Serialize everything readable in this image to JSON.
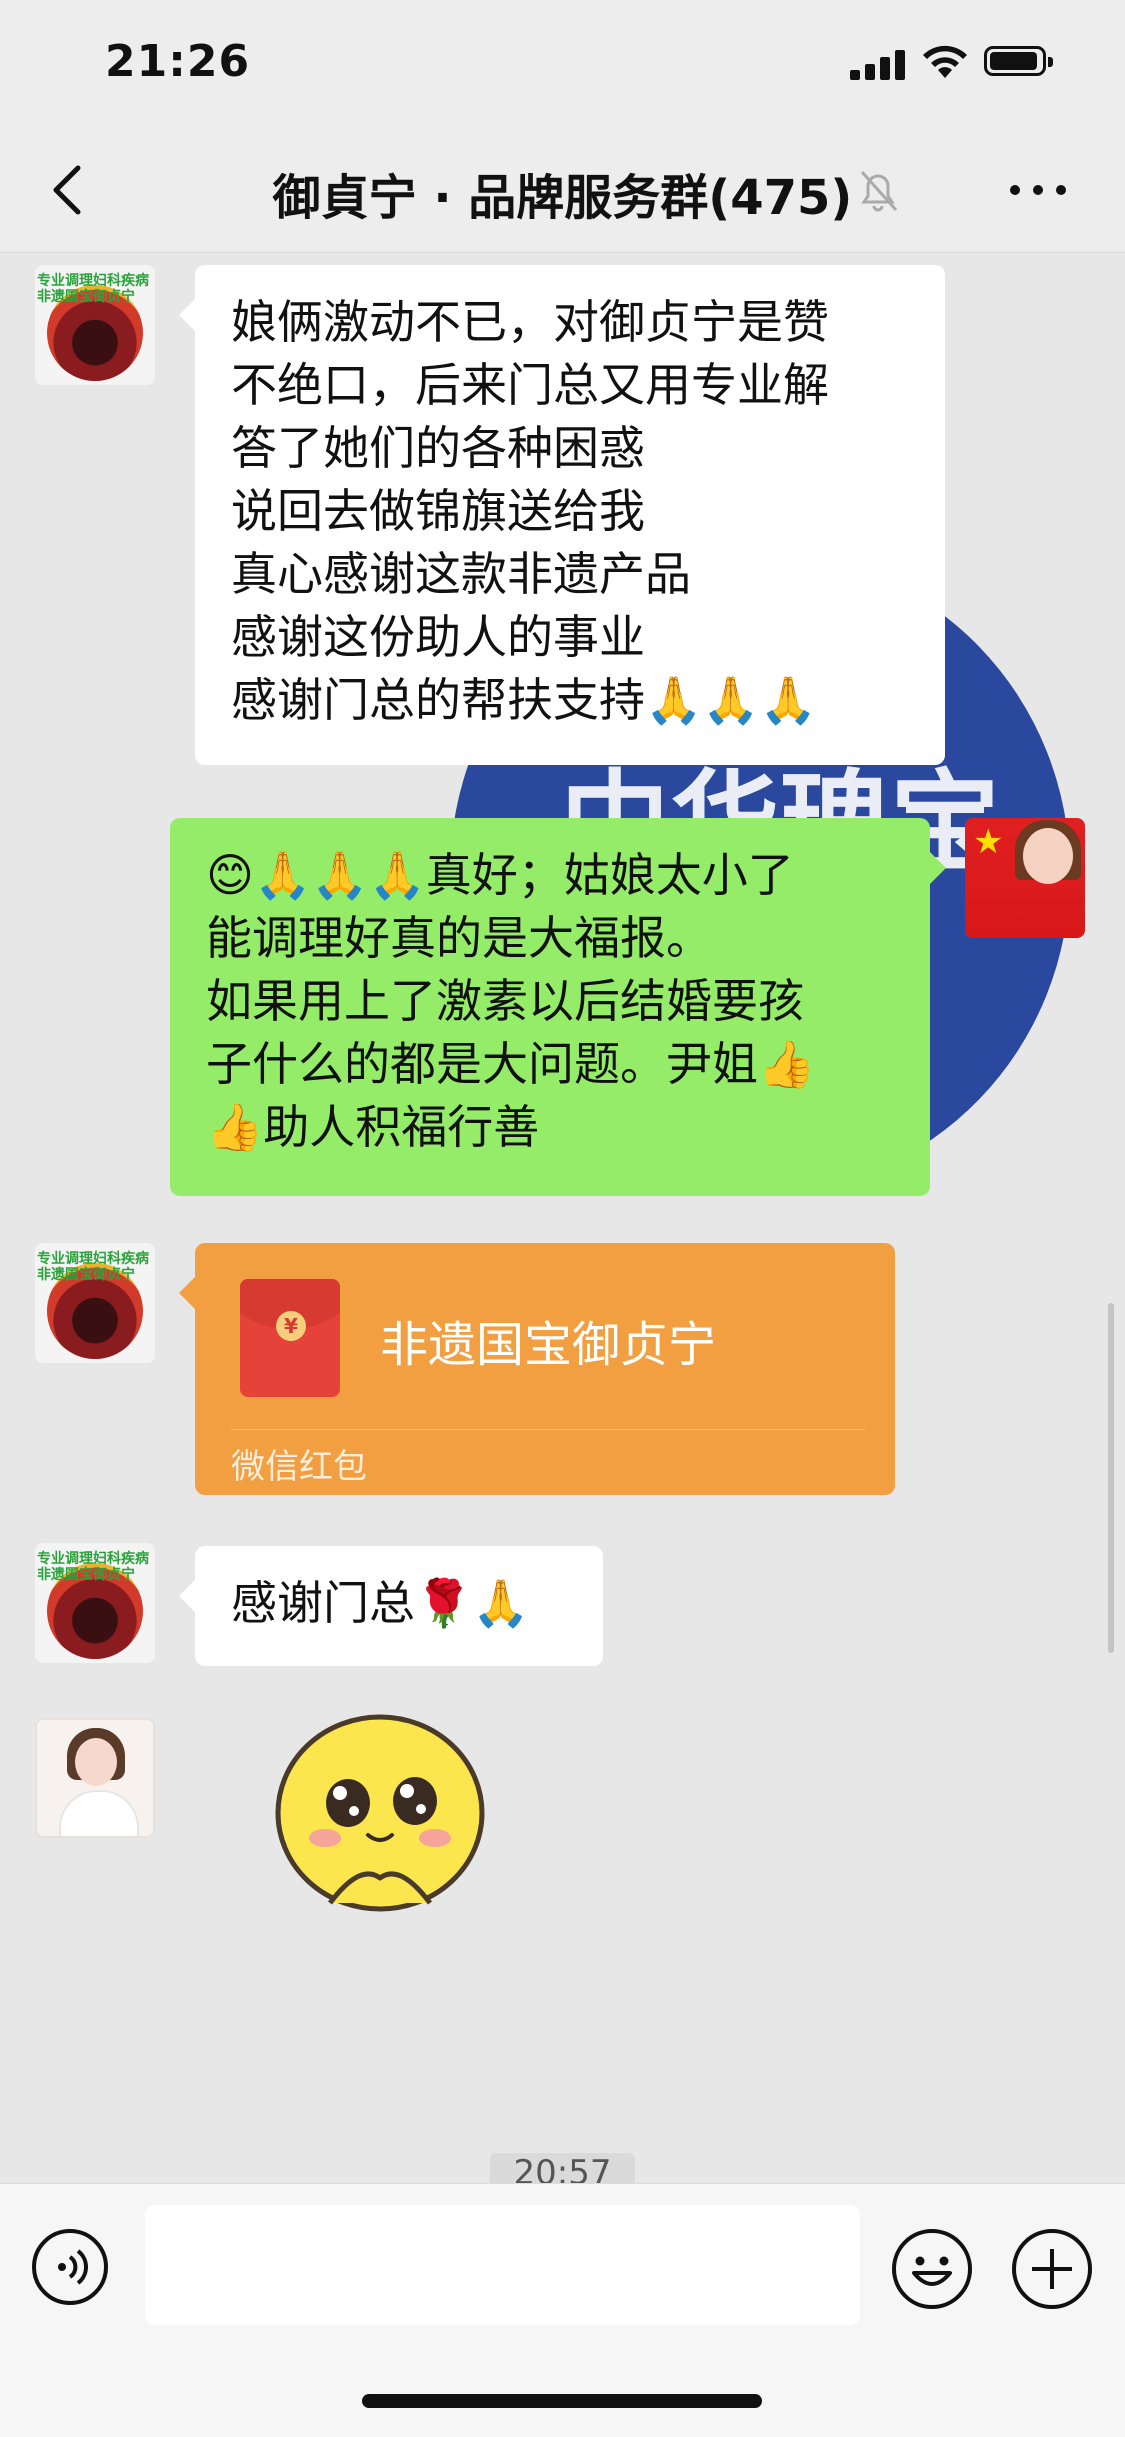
{
  "status_bar": {
    "time": "21:26"
  },
  "nav": {
    "title": "御貞宁 · 品牌服务群(475)"
  },
  "messages": {
    "m1_lines": [
      "娘俩激动不已，对御贞宁是赞",
      "不绝口，后来门总又用专业解",
      "答了她们的各种困惑",
      "说回去做锦旗送给我",
      "真心感谢这款非遗产品",
      "感谢这份助人的事业",
      "感谢门总的帮扶支持🙏🙏🙏"
    ],
    "m2_lines": [
      "😊🙏🙏🙏真好；姑娘太小了",
      "能调理好真的是大福报。",
      "如果用上了激素以后结婚要孩",
      "子什么的都是大问题。尹姐👍",
      "👍助人积福行善"
    ],
    "red_packet": {
      "title": "非遗国宝御贞宁",
      "label": "微信红包",
      "coin": "¥"
    },
    "m4_text": "感谢门总🌹🙏"
  },
  "avatar_flower_text": [
    "专业调理妇科疾病",
    "非遗国宝御贞宁"
  ],
  "background_banner_text": "中华瑰宝",
  "timestamp": "20:57",
  "colors": {
    "green_bubble": "#95ec69",
    "red_packet": "#f29f42",
    "chat_bg": "#e7e7e7"
  }
}
